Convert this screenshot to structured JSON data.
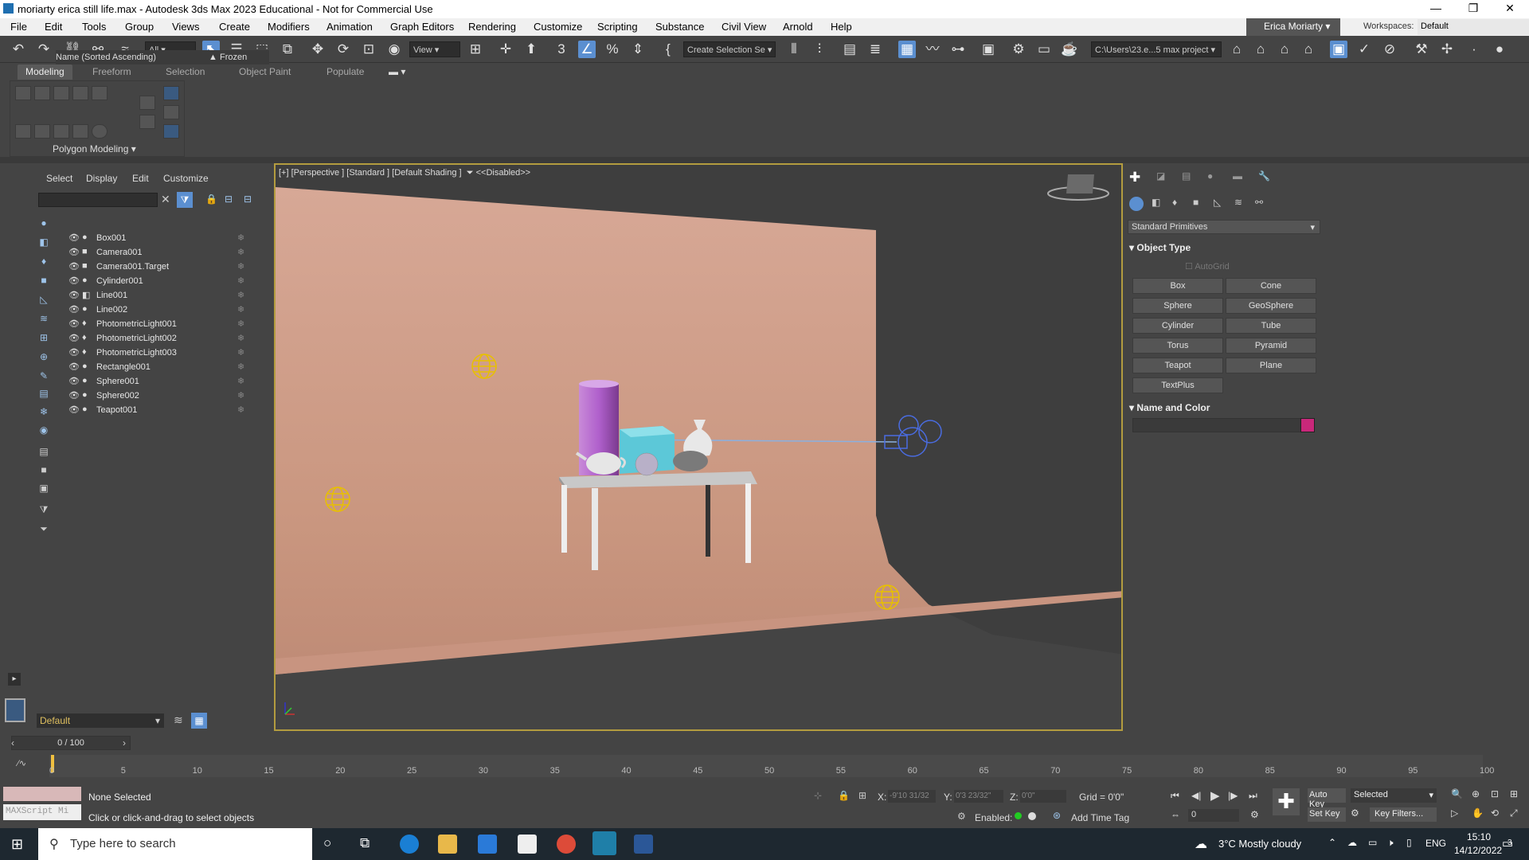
{
  "window": {
    "title": "moriarty erica still life.max - Autodesk 3ds Max 2023 Educational - Not for Commercial Use"
  },
  "menus": [
    "File",
    "Edit",
    "Tools",
    "Group",
    "Views",
    "Create",
    "Modifiers",
    "Animation",
    "Graph Editors",
    "Rendering",
    "Customize",
    "Scripting",
    "Substance",
    "Civil View",
    "Arnold",
    "Help"
  ],
  "user": {
    "name": "Erica Moriarty"
  },
  "workspace": {
    "label": "Workspaces:",
    "value": "Default"
  },
  "toolbar": {
    "filter": "All",
    "view": "View",
    "selection_set": "Create Selection Se",
    "project_path": "C:\\Users\\23.e...5 max project"
  },
  "ribbon": {
    "tabs": [
      "Modeling",
      "Freeform",
      "Selection",
      "Object Paint",
      "Populate"
    ],
    "panel_label": "Polygon Modeling"
  },
  "explorer": {
    "menus": [
      "Select",
      "Display",
      "Edit",
      "Customize"
    ],
    "col_name": "Name (Sorted Ascending)",
    "col_frozen": "Frozen",
    "rows": [
      {
        "name": "Box001",
        "type": "●"
      },
      {
        "name": "Camera001",
        "type": "■"
      },
      {
        "name": "Camera001.Target",
        "type": "■"
      },
      {
        "name": "Cylinder001",
        "type": "●"
      },
      {
        "name": "Line001",
        "type": "◧"
      },
      {
        "name": "Line002",
        "type": "●"
      },
      {
        "name": "PhotometricLight001",
        "type": "♦"
      },
      {
        "name": "PhotometricLight002",
        "type": "♦"
      },
      {
        "name": "PhotometricLight003",
        "type": "♦"
      },
      {
        "name": "Rectangle001",
        "type": "●"
      },
      {
        "name": "Sphere001",
        "type": "●"
      },
      {
        "name": "Sphere002",
        "type": "●"
      },
      {
        "name": "Teapot001",
        "type": "●"
      }
    ],
    "layer": "Default"
  },
  "viewport": {
    "label": "[+] [Perspective ] [Standard ] [Default Shading ]",
    "disabled": "<<Disabled>>"
  },
  "command_panel": {
    "category": "Standard Primitives",
    "object_type": "Object Type",
    "autogrid": "AutoGrid",
    "buttons": [
      "Box",
      "Cone",
      "Sphere",
      "GeoSphere",
      "Cylinder",
      "Tube",
      "Torus",
      "Pyramid",
      "Teapot",
      "Plane",
      "TextPlus"
    ],
    "name_color": "Name and Color",
    "swatch": "#c8287a"
  },
  "timeline": {
    "frame": "0 / 100",
    "ticks": [
      "0",
      "5",
      "10",
      "15",
      "20",
      "25",
      "30",
      "35",
      "40",
      "45",
      "50",
      "55",
      "60",
      "65",
      "70",
      "75",
      "80",
      "85",
      "90",
      "95",
      "100"
    ]
  },
  "status": {
    "selection": "None Selected",
    "prompt": "Click or click-and-drag to select objects",
    "maxscript": "MAXScript Mi",
    "x": "-9'10 31/32",
    "y": "0'3 23/32\"",
    "z": "0'0\"",
    "grid": "Grid = 0'0\"",
    "enabled": "Enabled:",
    "add_time_tag": "Add Time Tag",
    "auto_key": "Auto Key",
    "selected": "Selected",
    "set_key": "Set Key",
    "key_filters": "Key Filters...",
    "frame_field": "0"
  },
  "taskbar": {
    "search": "Type here to search",
    "weather": "3°C  Mostly cloudy",
    "lang": "ENG",
    "time": "15:10",
    "date": "14/12/2022",
    "notif": "3"
  }
}
